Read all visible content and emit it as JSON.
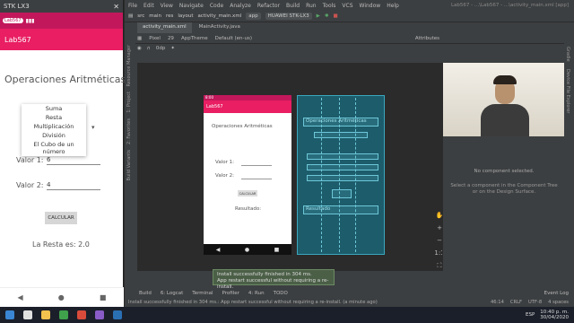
{
  "phone": {
    "window_title": "STK LX3",
    "status_chip": "Lab567",
    "app_title": "Lab567",
    "heading": "Operaciones Aritméticas",
    "dropdown_options": [
      "Suma",
      "Resta",
      "Multiplicación",
      "División",
      "El Cubo de un número"
    ],
    "valor1_label": "Valor 1:",
    "valor1_value": "6",
    "valor2_label": "Valor 2:",
    "valor2_value": "4",
    "calc_button": "CALCULAR",
    "result": "La Resta es: 2.0"
  },
  "ide": {
    "menu": [
      "File",
      "Edit",
      "View",
      "Navigate",
      "Code",
      "Analyze",
      "Refactor",
      "Build",
      "Run",
      "Tools",
      "VCS",
      "Window",
      "Help"
    ],
    "window_title": "Lab567 - ...\\Lab567 - ...\\activity_main.xml [app]",
    "breadcrumb": [
      "src",
      "main",
      "res",
      "layout",
      "activity_main.xml"
    ],
    "run_config": "app",
    "device": "HUAWEI STK-LX3",
    "tabs": [
      "activity_main.xml",
      "MainActivity.java"
    ],
    "design_toolbar": [
      "Pixel",
      "29",
      "AppTheme",
      "Default (en-us)"
    ],
    "zoom_value": "0dp",
    "attributes_title": "Attributes",
    "no_component": "No component selected.",
    "hint": "Select a component in the Component Tree or on the Design Surface.",
    "toast": "Install successfully finished in 304 ms.\nApp restart successful without requiring a re-install.",
    "bottom_tools": [
      "Build",
      "6: Logcat",
      "Terminal",
      "Profiler",
      "4: Run",
      "TODO"
    ],
    "event_log": "Event Log",
    "status_message": "Install successfully finished in 304 ms.: App restart successful without requiring a re-install. (a minute ago)",
    "status_right": [
      "46:14",
      "CRLF",
      "UTF-8",
      "4 spaces"
    ],
    "left_strip": [
      "Resource Manager",
      "1: Project",
      "2: Favorites",
      "Build Variants",
      "Z: Structure",
      "Layout Captures"
    ],
    "right_strip": [
      "Gradle",
      "Device File Explorer"
    ]
  },
  "preview": {
    "app": "Lab567",
    "heading": "Operaciones Aritméticas",
    "valor1": "Valor 1:",
    "valor2": "Valor 2:",
    "button": "CALCULAR",
    "result": "Resultado:"
  },
  "blueprint": {
    "heading": "Operaciones Aritméticas",
    "result": "Resultado"
  },
  "taskbar": {
    "lang": "ESP",
    "time": "10:40 p. m.",
    "date": "30/04/2020"
  }
}
